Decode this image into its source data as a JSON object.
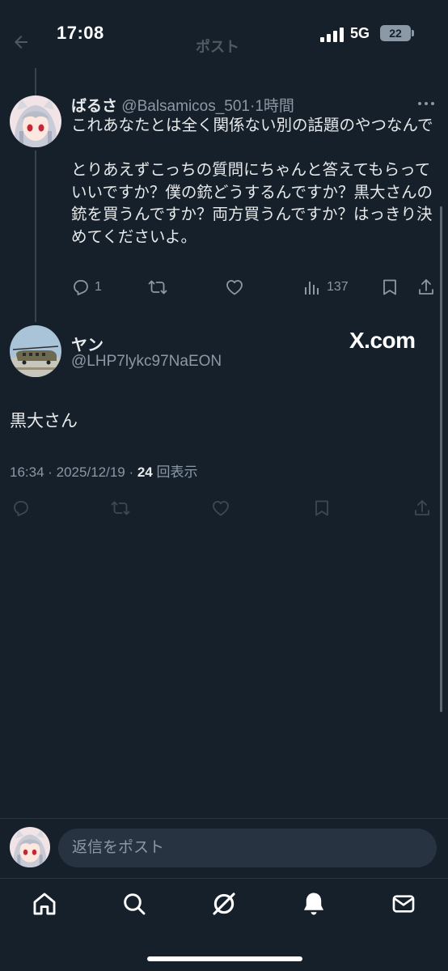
{
  "status_bar": {
    "time": "17:08",
    "network": "5G",
    "battery": "22"
  },
  "header": {
    "title": "ポスト"
  },
  "reply_tweet": {
    "author_name": "ばるさ",
    "handle": "@Balsamicos_501",
    "separator": "·",
    "time_ago": "1時間",
    "text_paragraphs": [
      "これあなたとは全く関係ない別の話題のやつなんで",
      "とりあえずこっちの質問にちゃんと答えてもらっていいですか？僕の銃どうするんですか？黒大さんの銃を買うんですか？両方買うんですか？はっきり決めてくださいよ。"
    ],
    "reply_count": "1",
    "views_count": "137",
    "icons": [
      "reply-icon",
      "retweet-icon",
      "like-icon",
      "views-icon",
      "bookmark-icon",
      "share-icon"
    ]
  },
  "main_tweet": {
    "author_name": "ヤン",
    "handle": "@LHP7lykc97NaEON",
    "watermark": "X.com",
    "text": "黒大さん",
    "timestamp": "16:34 · 2025/12/19 · ",
    "views_count": "24",
    "views_suffix": " 回表示"
  },
  "reply_bar": {
    "placeholder": "返信をポスト"
  },
  "bottom_nav": {
    "items": [
      "home-icon",
      "search-icon",
      "grok-icon",
      "notifications-icon",
      "messages-icon"
    ]
  },
  "colors": {
    "background": "#15202b",
    "text_primary": "#e7e9ea",
    "text_secondary": "#8b98a5",
    "border": "#2f3336",
    "input_bg": "#273340"
  }
}
